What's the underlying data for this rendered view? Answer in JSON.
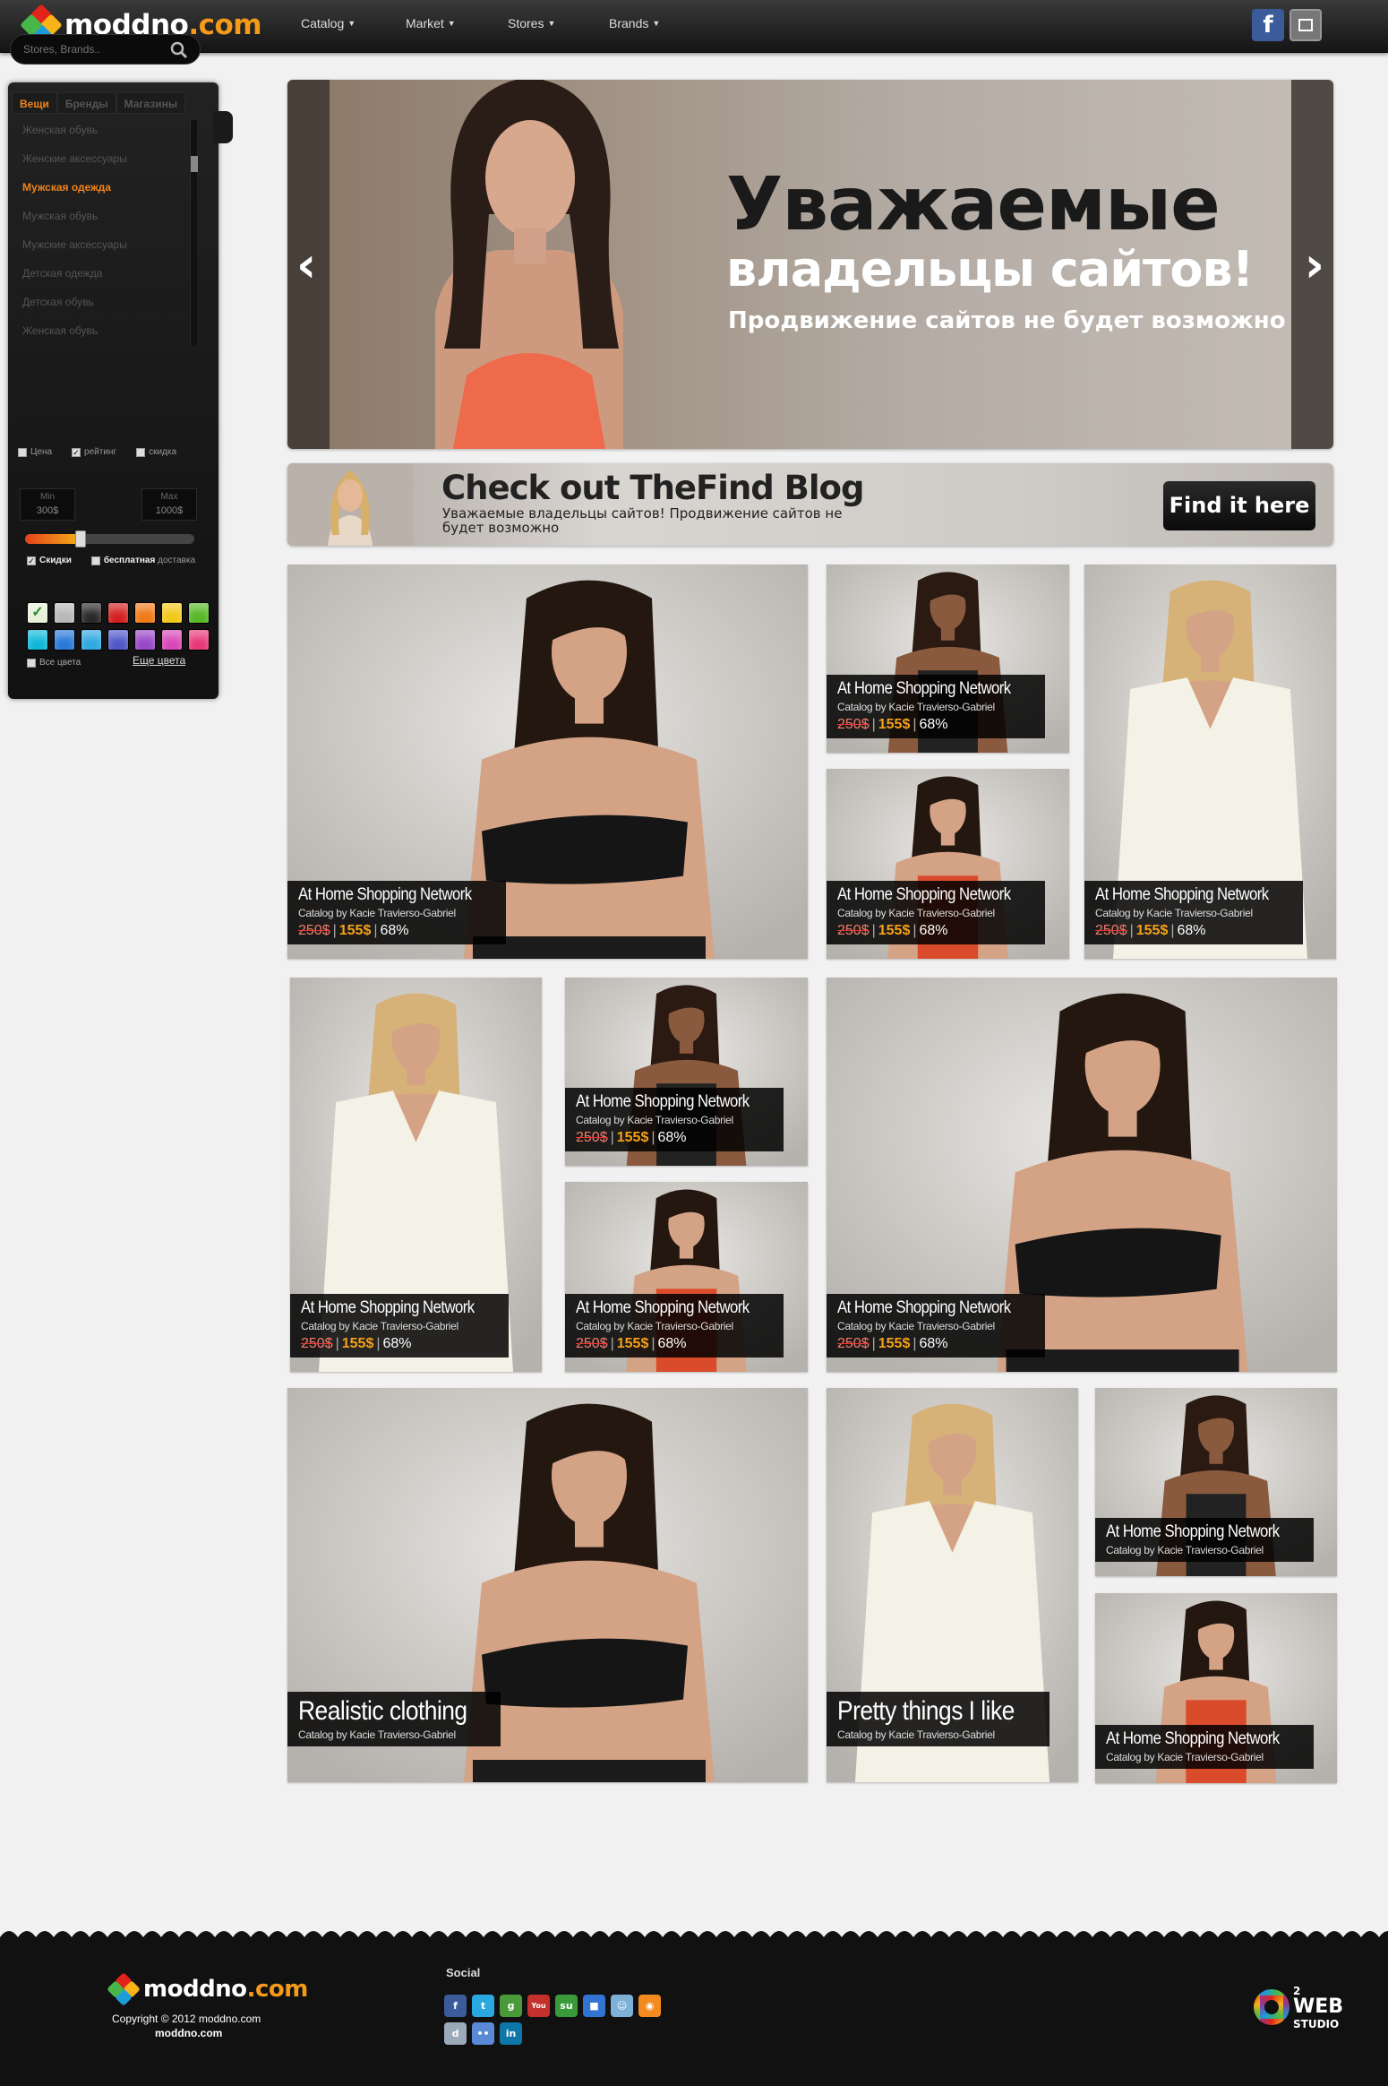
{
  "header": {
    "logo_name": "moddno",
    "logo_domain": ".com",
    "nav": [
      "Catalog",
      "Market",
      "Stores",
      "Brands"
    ],
    "facebook_icon": "facebook-icon",
    "bookmark_icon": "bookmark-icon"
  },
  "sidebar": {
    "search_placeholder": "Stores, Brands..",
    "tabs": [
      "Вещи",
      "Бренды",
      "Магазины"
    ],
    "categories": [
      "Женская обувь",
      "Женские аксессуары",
      "Мужская одежда",
      "Мужская обувь",
      "Мужские аксессуары",
      "Детская одежда",
      "Детская обувь",
      "Женская обувь"
    ],
    "active_category_index": 2,
    "sort_options": [
      "Цена",
      "рейтинг",
      "скидка"
    ],
    "sort_checked": [
      false,
      true,
      false
    ],
    "range": {
      "min_label": "Min",
      "max_label": "Max",
      "min_value": "300$",
      "max_value": "1000$",
      "position": 0.33
    },
    "filter_discounts": "Скидки",
    "filter_discounts_checked": true,
    "filter_shipping_bold": "бесплатная",
    "filter_shipping": "доставка",
    "filter_shipping_checked": false,
    "swatch_colors": [
      "#e8f0d8",
      "#b8b8b8",
      "#2a2a2a",
      "#d42020",
      "#f07a18",
      "#f2c81a",
      "#58b828",
      "#10b8d8",
      "#2a7ad8",
      "#30a8e0",
      "#5058c8",
      "#9a48c8",
      "#d848b8",
      "#e83a78"
    ],
    "all_colors": "Все цвета",
    "more_colors": "Еще цвета"
  },
  "hero": {
    "title_line1": "Уважаемые",
    "title_line2": "владельцы сайтов!",
    "subtitle": "Продвижение сайтов не будет возможно",
    "prev_icon": "chevron-left-icon",
    "next_icon": "chevron-right-icon"
  },
  "blog": {
    "title": "Check out TheFind Blog",
    "subtitle": "Уважаемые владельцы сайтов! Продвижение сайтов не будет возможно",
    "button": "Find it here"
  },
  "tiles": {
    "shop_title": "At Home Shopping Network",
    "catalog_by": "Catalog by Kacie Travierso-Gabriel",
    "price_old": "250$",
    "price_new": "155$",
    "discount": "68%",
    "realistic_title": "Realistic clothing",
    "pretty_title": "Pretty things I like"
  },
  "footer": {
    "copyright": "Copyright © 2012 moddno.com",
    "domain": "moddno.com",
    "social_label": "Social",
    "social_icons": [
      "facebook-icon",
      "twitter-icon",
      "google-plus-icon",
      "youtube-icon",
      "stumbleupon-icon",
      "delicious-icon",
      "reddit-icon",
      "rss-icon",
      "digg-icon",
      "flickr-icon",
      "linkedin-icon"
    ],
    "studio_num": "2",
    "studio_name": "WEB",
    "studio_sub": "STUDIO"
  }
}
